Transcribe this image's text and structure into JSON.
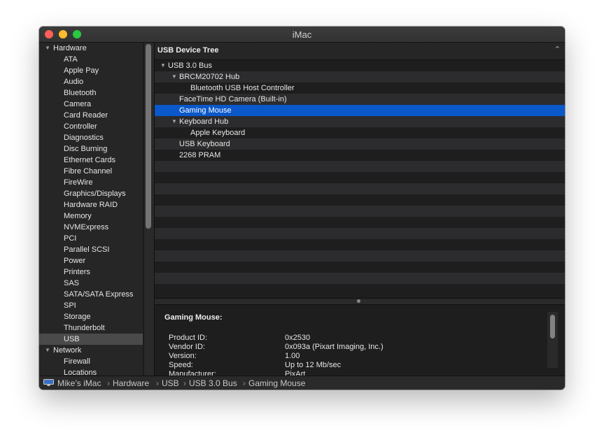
{
  "window": {
    "title": "iMac"
  },
  "sidebar": {
    "sections": [
      {
        "label": "Hardware",
        "items": [
          "ATA",
          "Apple Pay",
          "Audio",
          "Bluetooth",
          "Camera",
          "Card Reader",
          "Controller",
          "Diagnostics",
          "Disc Burning",
          "Ethernet Cards",
          "Fibre Channel",
          "FireWire",
          "Graphics/Displays",
          "Hardware RAID",
          "Memory",
          "NVMExpress",
          "PCI",
          "Parallel SCSI",
          "Power",
          "Printers",
          "SAS",
          "SATA/SATA Express",
          "SPI",
          "Storage",
          "Thunderbolt",
          "USB"
        ]
      },
      {
        "label": "Network",
        "items": [
          "Firewall",
          "Locations"
        ]
      }
    ],
    "selected": "USB"
  },
  "tree": {
    "header": "USB Device Tree",
    "rows": [
      {
        "label": "USB 3.0 Bus",
        "level": 0,
        "expanded": true
      },
      {
        "label": "BRCM20702 Hub",
        "level": 1,
        "expanded": true
      },
      {
        "label": "Bluetooth USB Host Controller",
        "level": 2
      },
      {
        "label": "FaceTime HD Camera (Built-in)",
        "level": 1
      },
      {
        "label": "Gaming Mouse",
        "level": 1,
        "selected": true
      },
      {
        "label": "Keyboard Hub",
        "level": 1,
        "expanded": true
      },
      {
        "label": "Apple Keyboard",
        "level": 2
      },
      {
        "label": "USB Keyboard",
        "level": 1
      },
      {
        "label": "2268 PRAM",
        "level": 1
      }
    ]
  },
  "detail": {
    "title": "Gaming Mouse:",
    "fields": [
      {
        "key": "Product ID:",
        "value": "0x2530"
      },
      {
        "key": "Vendor ID:",
        "value": "0x093a  (Pixart Imaging, Inc.)"
      },
      {
        "key": "Version:",
        "value": "1.00"
      },
      {
        "key": "Speed:",
        "value": "Up to 12 Mb/sec"
      },
      {
        "key": "Manufacturer:",
        "value": "PixArt"
      }
    ]
  },
  "pathbar": {
    "crumbs": [
      "Mike’s iMac",
      "Hardware",
      "USB",
      "USB 3.0 Bus",
      "Gaming Mouse"
    ],
    "separator": "›",
    "icon": "imac-icon"
  },
  "colors": {
    "selection": "#0a58ca",
    "sidebar_selection": "#4a4a4b",
    "window_bg": "#1e1e1e"
  }
}
